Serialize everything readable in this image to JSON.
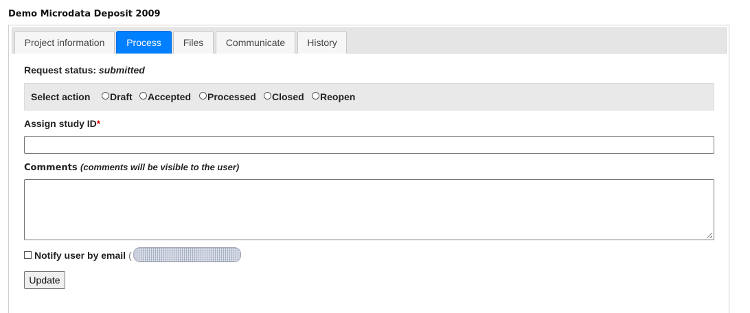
{
  "page": {
    "title": "Demo Microdata Deposit 2009"
  },
  "tabs": [
    {
      "label": "Project information",
      "active": false
    },
    {
      "label": "Process",
      "active": true
    },
    {
      "label": "Files",
      "active": false
    },
    {
      "label": "Communicate",
      "active": false
    },
    {
      "label": "History",
      "active": false
    }
  ],
  "status": {
    "label": "Request status:",
    "value": "submitted"
  },
  "action": {
    "label": "Select action",
    "options": [
      "Draft",
      "Accepted",
      "Processed",
      "Closed",
      "Reopen"
    ],
    "selected": null
  },
  "assign": {
    "label": "Assign study ID",
    "required_marker": "*",
    "value": ""
  },
  "comments": {
    "label": "Comments",
    "note": "(comments will be visible to the user)",
    "value": ""
  },
  "notify": {
    "label": "Notify user by email",
    "checked": false,
    "open_paren": "("
  },
  "buttons": {
    "update": "Update"
  },
  "colors": {
    "active_tab": "#007fff",
    "required": "#dd0000"
  }
}
